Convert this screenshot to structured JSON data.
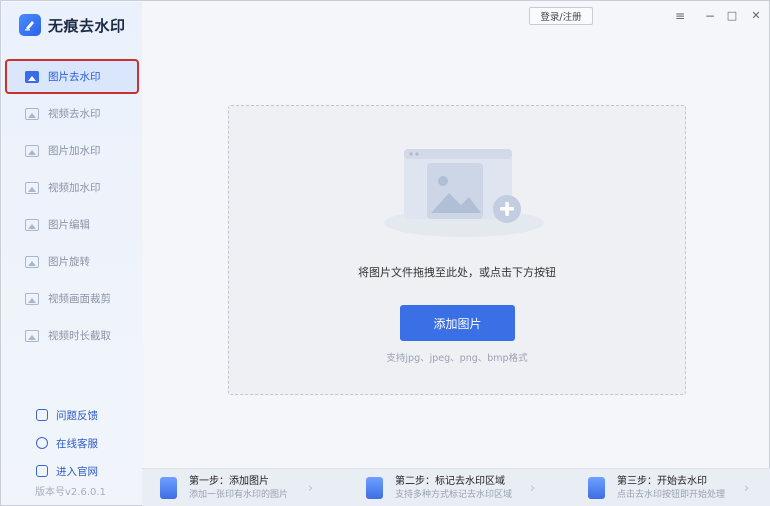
{
  "app": {
    "title": "无痕去水印",
    "accent": "#3b6fe6",
    "highlight_border": "#c8312c"
  },
  "topbar": {
    "login_label": "登录/注册",
    "menu_icon": "≡",
    "minimize_icon": "−",
    "maximize_icon": "□",
    "close_icon": "✕"
  },
  "sidebar": {
    "items": [
      {
        "label": "图片去水印",
        "icon": "image-icon",
        "active": true
      },
      {
        "label": "视频去水印",
        "icon": "video-icon",
        "active": false
      },
      {
        "label": "图片加水印",
        "icon": "image-add-icon",
        "active": false
      },
      {
        "label": "视频加水印",
        "icon": "video-add-icon",
        "active": false
      },
      {
        "label": "图片编辑",
        "icon": "image-edit-icon",
        "active": false
      },
      {
        "label": "图片旋转",
        "icon": "image-rotate-icon",
        "active": false
      },
      {
        "label": "视频画面裁剪",
        "icon": "video-crop-icon",
        "active": false
      },
      {
        "label": "视频时长截取",
        "icon": "video-trim-icon",
        "active": false
      }
    ],
    "links": [
      {
        "label": "问题反馈",
        "icon": "feedback-icon"
      },
      {
        "label": "在线客服",
        "icon": "support-icon"
      },
      {
        "label": "进入官网",
        "icon": "website-icon"
      }
    ],
    "version": "版本号v2.6.0.1"
  },
  "main": {
    "drop_hint": "将图片文件拖拽至此处，或点击下方按钮",
    "add_button": "添加图片",
    "formats": "支持jpg、jpeg、png、bmp格式"
  },
  "steps": [
    {
      "title": "第一步：添加图片",
      "sub": "添加一张印有水印的图片"
    },
    {
      "title": "第二步：标记去水印区域",
      "sub": "支持多种方式标记去水印区域"
    },
    {
      "title": "第三步：开始去水印",
      "sub": "点击去水印按钮即开始处理"
    }
  ]
}
